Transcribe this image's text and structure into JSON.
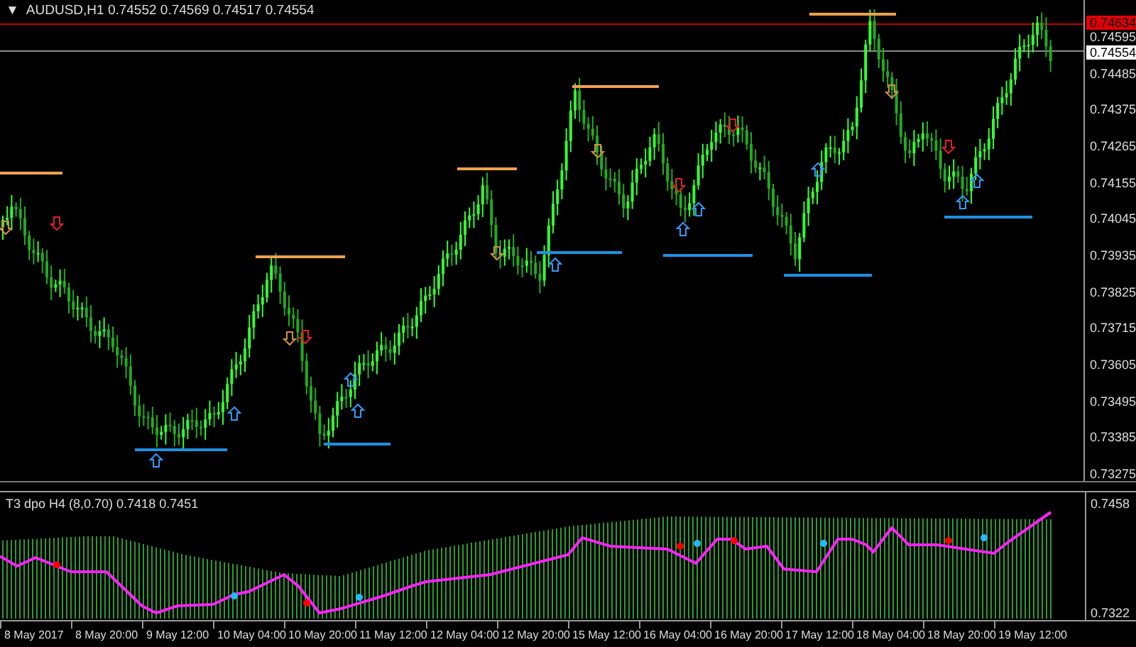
{
  "chart": {
    "caret": "▼",
    "header": "AUDUSD,H1  0.74552 0.74569 0.74517 0.74554",
    "price_axis": [
      "0.74595",
      "0.74485",
      "0.74375",
      "0.74265",
      "0.74155",
      "0.74045",
      "0.73935",
      "0.73825",
      "0.73715",
      "0.73605",
      "0.73495",
      "0.73385",
      "0.73275"
    ],
    "ask_label": "0.74634",
    "bid_label": "0.74554"
  },
  "indicator": {
    "label": "T3 dpo H4 (8,0.70) 0.7418 0.7451",
    "axis": [
      "0.7458",
      "0.7322"
    ]
  },
  "time_axis": [
    "8 May 2017",
    "8 May 20:00",
    "9 May 12:00",
    "10 May 04:00",
    "10 May 20:00",
    "11 May 12:00",
    "12 May 04:00",
    "12 May 20:00",
    "15 May 12:00",
    "16 May 04:00",
    "16 May 20:00",
    "17 May 12:00",
    "18 May 04:00",
    "18 May 20:00",
    "19 May 12:00"
  ]
}
